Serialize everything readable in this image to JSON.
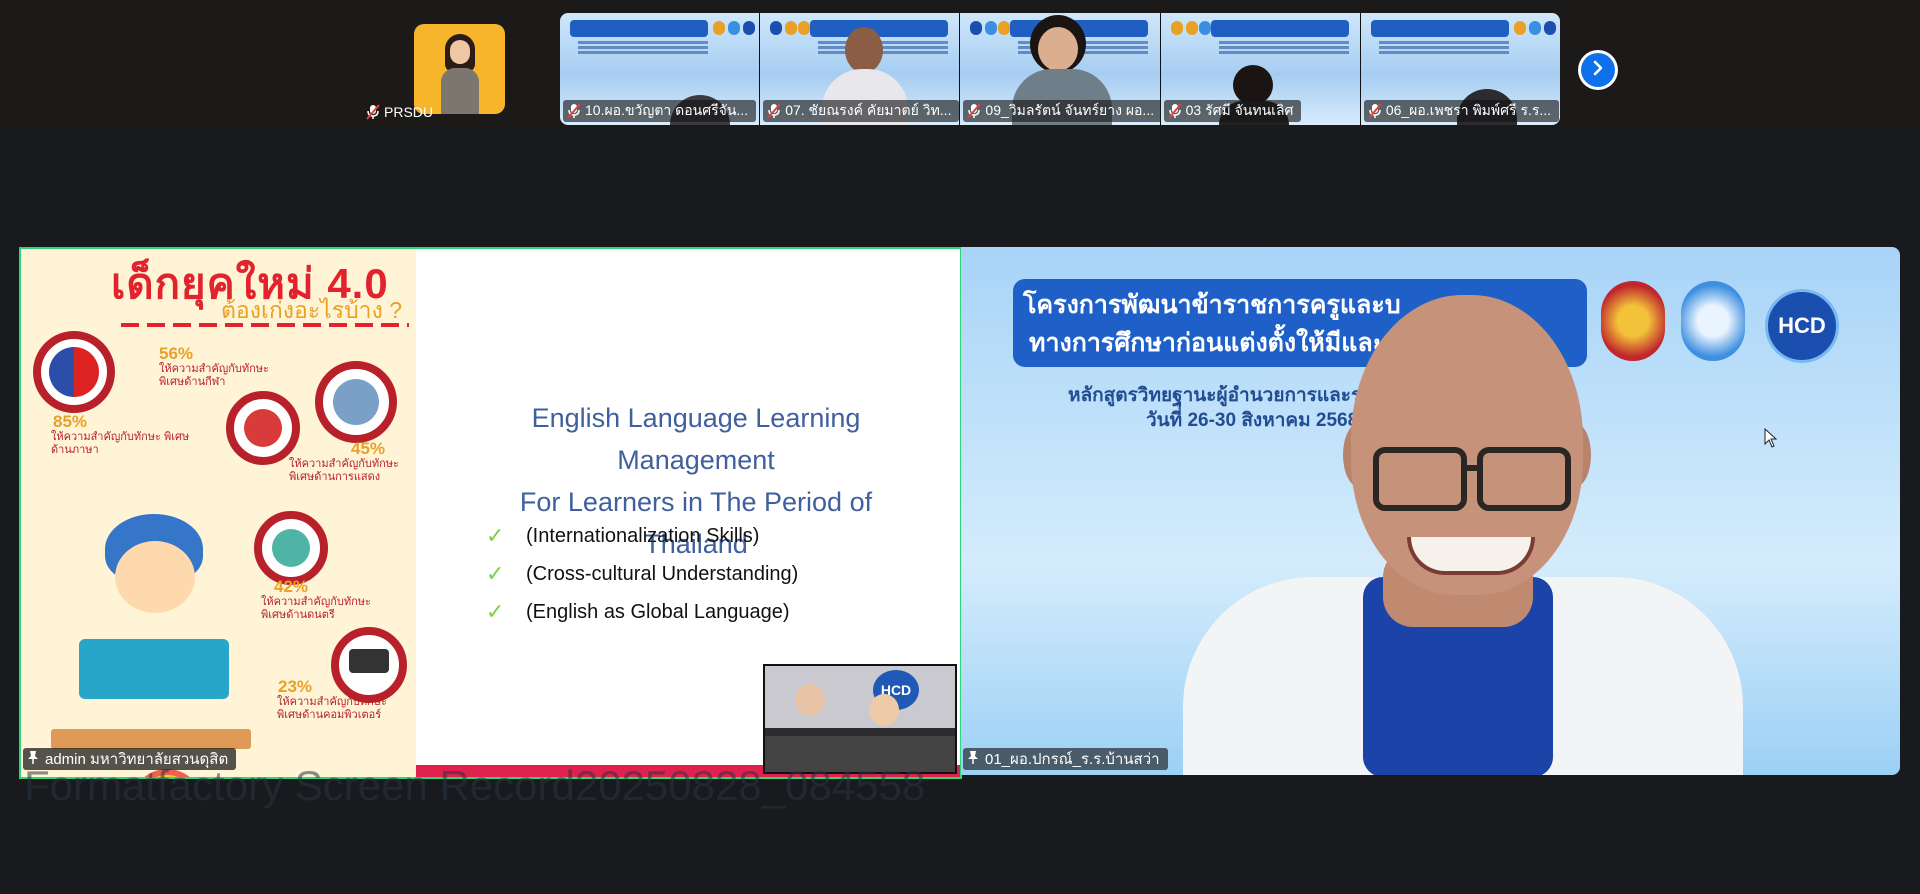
{
  "self_view": {
    "name": "PRSDU"
  },
  "gallery": {
    "tiles": [
      {
        "name": "10.ผอ.ขวัญตา ดอนศรีจัน..."
      },
      {
        "name": "07. ชัยณรงค์ คัยมาตย์ วิท..."
      },
      {
        "name": "09_วิมลรัตน์ จันทร์ยาง ผอ..."
      },
      {
        "name": "03 รัศมี จันทนเลิศ"
      },
      {
        "name": "06_ผอ.เพชรา พิมพ์ศรี ร.ร..."
      }
    ]
  },
  "share": {
    "presenter": "admin มหาวิทยาลัยสวนดุสิต",
    "infographic": {
      "title": "เด็กยุคใหม่ 4.0",
      "subtitle": "ต้องเก่งอะไรบ้าง ?",
      "stats": [
        {
          "pct": "56%",
          "desc": "ให้ความสำคัญกับทักษะ พิเศษด้านกีฬา"
        },
        {
          "pct": "85%",
          "desc": "ให้ความสำคัญกับทักษะ พิเศษด้านภาษา"
        },
        {
          "pct": "45%",
          "desc": "ให้ความสำคัญกับทักษะ พิเศษด้านการแสดง"
        },
        {
          "pct": "42%",
          "desc": "ให้ความสำคัญกับทักษะ พิเศษด้านดนตรี"
        },
        {
          "pct": "23%",
          "desc": "ให้ความสำคัญกับทักษะ พิเศษด้านคอมพิวเตอร์"
        }
      ]
    },
    "slide": {
      "title_line1": "English Language Learning Management",
      "title_line2": "For Learners in The Period of Thailand",
      "bullets": [
        "(Internationalization Skills)",
        "(Cross-cultural Understanding)",
        "(English as Global Language)"
      ]
    },
    "pip_logo": "HCD"
  },
  "speaker": {
    "name": "01_ผอ.ปกรณ์_ร.ร.บ้านสว่า",
    "banner_line1": "โครงการพัฒนาข้าราชการครูและบ",
    "banner_line2": "ทางการศึกษาก่อนแต่งตั้งให้มีและเ",
    "sub_line1": "หลักสูตรวิทยฐานะผู้อำนวยการและรอง",
    "sub_line2": "วันที่ 26-30 สิงหาคม 2568",
    "logo_text": "HCD"
  },
  "watermark": "Formatfactory Screen Record20250828_084558",
  "colors": {
    "accent_blue": "#0e71eb",
    "active_border": "#2ed67a",
    "mic_off_red": "#e0413a"
  },
  "icons": {
    "mic": "mic-off-icon",
    "next": "chevron-right-icon",
    "pin": "pin-icon",
    "check": "check-icon",
    "cursor": "mouse-pointer-icon"
  }
}
